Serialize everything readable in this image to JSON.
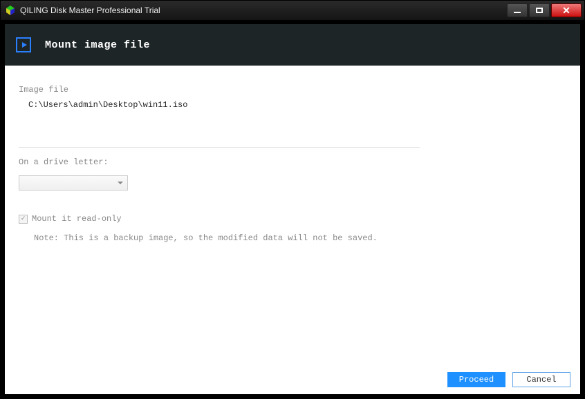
{
  "window": {
    "title": "QILING Disk Master Professional Trial"
  },
  "header": {
    "title": "Mount image file"
  },
  "imagefile": {
    "label": "Image file",
    "path": "C:\\Users\\admin\\Desktop\\win11.iso"
  },
  "driveletter": {
    "label": "On a drive letter:",
    "value": ""
  },
  "readonly": {
    "label": "Mount it read-only",
    "checked": true
  },
  "note": "Note: This is a backup image, so the modified data will not be saved.",
  "buttons": {
    "proceed": "Proceed",
    "cancel": "Cancel"
  }
}
